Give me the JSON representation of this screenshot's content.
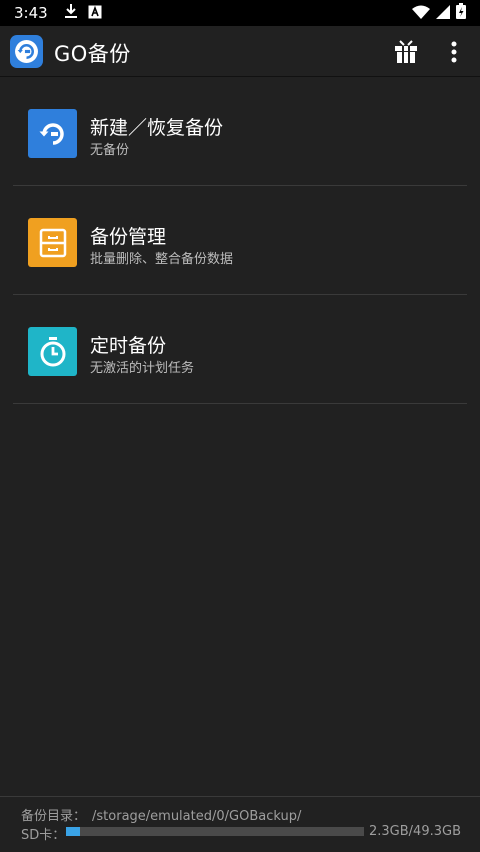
{
  "status_bar": {
    "time": "3:43",
    "left_icons": [
      "download-icon",
      "a-icon"
    ],
    "right_icons": [
      "wifi-icon",
      "signal-icon",
      "battery-icon"
    ]
  },
  "toolbar": {
    "title": "GO备份",
    "actions": [
      "gift-icon",
      "more-vert-icon"
    ]
  },
  "items": [
    {
      "title": "新建／恢复备份",
      "subtitle": "无备份",
      "icon": "restore-icon",
      "color": "#2f7fdc"
    },
    {
      "title": "备份管理",
      "subtitle": "批量删除、整合备份数据",
      "icon": "cabinet-icon",
      "color": "#f0a020"
    },
    {
      "title": "定时备份",
      "subtitle": "无激活的计划任务",
      "icon": "timer-icon",
      "color": "#1fb5c8"
    }
  ],
  "footer": {
    "dir_label": "备份目录：",
    "dir_path": "/storage/emulated/0/GOBackup/",
    "sd_label": "SD卡：",
    "storage_text": "2.3GB/49.3GB",
    "used_fraction": 0.047
  }
}
